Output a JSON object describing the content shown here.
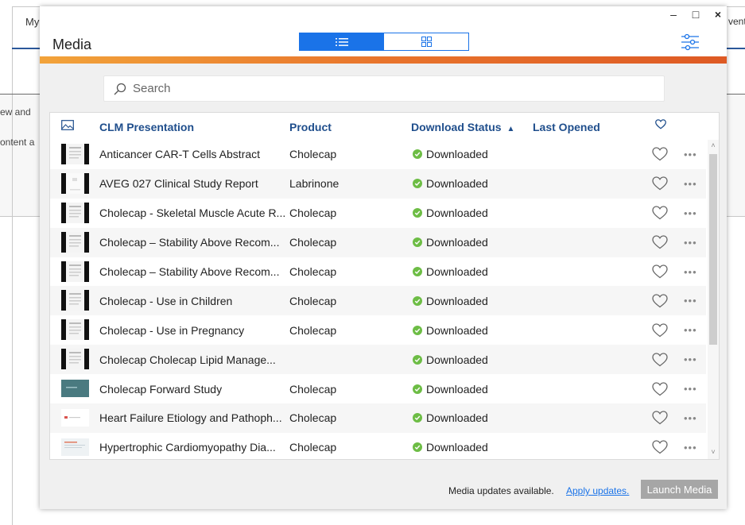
{
  "background": {
    "tab_left": "My",
    "tab_right": "vent",
    "text_line_1": "ew and",
    "text_line_2": "ontent a"
  },
  "modal": {
    "title": "Media",
    "window_controls": {
      "minimize": "–",
      "maximize": "□",
      "close": "×"
    },
    "view_toggle": {
      "list_icon": "list-icon",
      "grid_icon": "grid-icon",
      "active": "list"
    },
    "filter_icon": "filter-sliders-icon",
    "accent_gradient": [
      "#f2a33a",
      "#de5a24"
    ]
  },
  "search": {
    "placeholder": "Search"
  },
  "table": {
    "columns": {
      "thumb_icon": "image-icon",
      "presentation": "CLM Presentation",
      "product": "Product",
      "status": "Download Status",
      "status_sort": "▲",
      "last_opened": "Last Opened",
      "favorite_icon": "heart-icon"
    },
    "rows": [
      {
        "name": "Anticancer CAR-T Cells Abstract",
        "product": "Cholecap",
        "status": "Downloaded",
        "last_opened": "",
        "thumb": "doc"
      },
      {
        "name": "AVEG 027 Clinical Study Report",
        "product": "Labrinone",
        "status": "Downloaded",
        "last_opened": "",
        "thumb": "doc-light"
      },
      {
        "name": "Cholecap - Skeletal Muscle Acute R...",
        "product": "Cholecap",
        "status": "Downloaded",
        "last_opened": "",
        "thumb": "doc"
      },
      {
        "name": "Cholecap – Stability Above Recom...",
        "product": "Cholecap",
        "status": "Downloaded",
        "last_opened": "",
        "thumb": "doc"
      },
      {
        "name": "Cholecap – Stability Above Recom...",
        "product": "Cholecap",
        "status": "Downloaded",
        "last_opened": "",
        "thumb": "doc"
      },
      {
        "name": "Cholecap - Use in Children",
        "product": "Cholecap",
        "status": "Downloaded",
        "last_opened": "",
        "thumb": "doc"
      },
      {
        "name": "Cholecap - Use in Pregnancy",
        "product": "Cholecap",
        "status": "Downloaded",
        "last_opened": "",
        "thumb": "doc"
      },
      {
        "name": "Cholecap Cholecap Lipid Manage...",
        "product": "",
        "status": "Downloaded",
        "last_opened": "",
        "thumb": "doc"
      },
      {
        "name": "Cholecap Forward Study",
        "product": "Cholecap",
        "status": "Downloaded",
        "last_opened": "",
        "thumb": "slide-teal"
      },
      {
        "name": "Heart Failure Etiology and Pathoph...",
        "product": "Cholecap",
        "status": "Downloaded",
        "last_opened": "",
        "thumb": "slide-white"
      },
      {
        "name": "Hypertrophic Cardiomyopathy Dia...",
        "product": "Cholecap",
        "status": "Downloaded",
        "last_opened": "",
        "thumb": "slide-pale"
      }
    ],
    "more_label": "•••"
  },
  "footer": {
    "message": "Media updates available.",
    "link": "Apply updates.",
    "launch_button": "Launch Media"
  },
  "colors": {
    "accent_blue": "#1a73e8",
    "header_blue": "#1f4e8c",
    "status_green": "#6dbd45",
    "disabled_gray": "#a6a6a6"
  }
}
